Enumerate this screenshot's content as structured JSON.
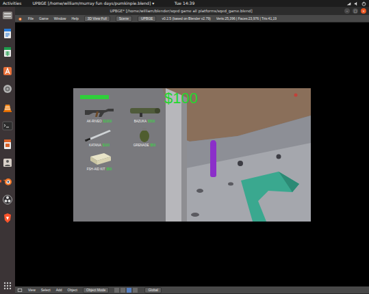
{
  "topbar": {
    "activities": "Activities",
    "app": "UPBGE [/home/william/murray fun days/pumkinpie.blend] ▾",
    "clock": "Tue 14:39"
  },
  "dock": [
    {
      "kind": "files",
      "running": false
    },
    {
      "kind": "writer",
      "running": false
    },
    {
      "kind": "calc",
      "running": false
    },
    {
      "kind": "software",
      "running": false
    },
    {
      "kind": "settings",
      "running": false
    },
    {
      "kind": "vlc",
      "running": false
    },
    {
      "kind": "terminal",
      "running": false
    },
    {
      "kind": "impress",
      "running": false
    },
    {
      "kind": "viewer",
      "running": false
    },
    {
      "kind": "blender",
      "running": true
    },
    {
      "kind": "obs",
      "running": false
    },
    {
      "kind": "brave",
      "running": false
    },
    {
      "kind": "apps",
      "running": false
    }
  ],
  "window": {
    "title": "UPBGE* [/home/william/blender/sqed game all platforms/sqed_game.blend]",
    "controls": [
      "–",
      "□",
      "×"
    ]
  },
  "info_header": {
    "menus": [
      "File",
      "Game",
      "Window",
      "Help"
    ],
    "screen": "3D View Full",
    "scene": "Scene",
    "engine": "UPBGE",
    "version": "v0.2.5 (based on Blender v2.79)",
    "stats": "Verts:25,396 | Faces:23,976 | Tris:41,19"
  },
  "game": {
    "money": "$100",
    "health": 1,
    "shop": [
      {
        "kind": "rifle",
        "name": "AK-RIVEO",
        "price": "$1000"
      },
      {
        "kind": "bazooka",
        "name": "BAZUKA",
        "price": "$500"
      },
      {
        "kind": "katana",
        "name": "KATANA",
        "price": "$100"
      },
      {
        "kind": "grenade",
        "name": "GRENADE",
        "price": "$50"
      },
      {
        "kind": "medkit",
        "name": "FSH-AID KIT",
        "price": "$50"
      }
    ]
  },
  "bottom_header": {
    "menus": [
      "View",
      "Select",
      "Add",
      "Object"
    ],
    "mode": "Object Mode",
    "orientation": "Global"
  }
}
